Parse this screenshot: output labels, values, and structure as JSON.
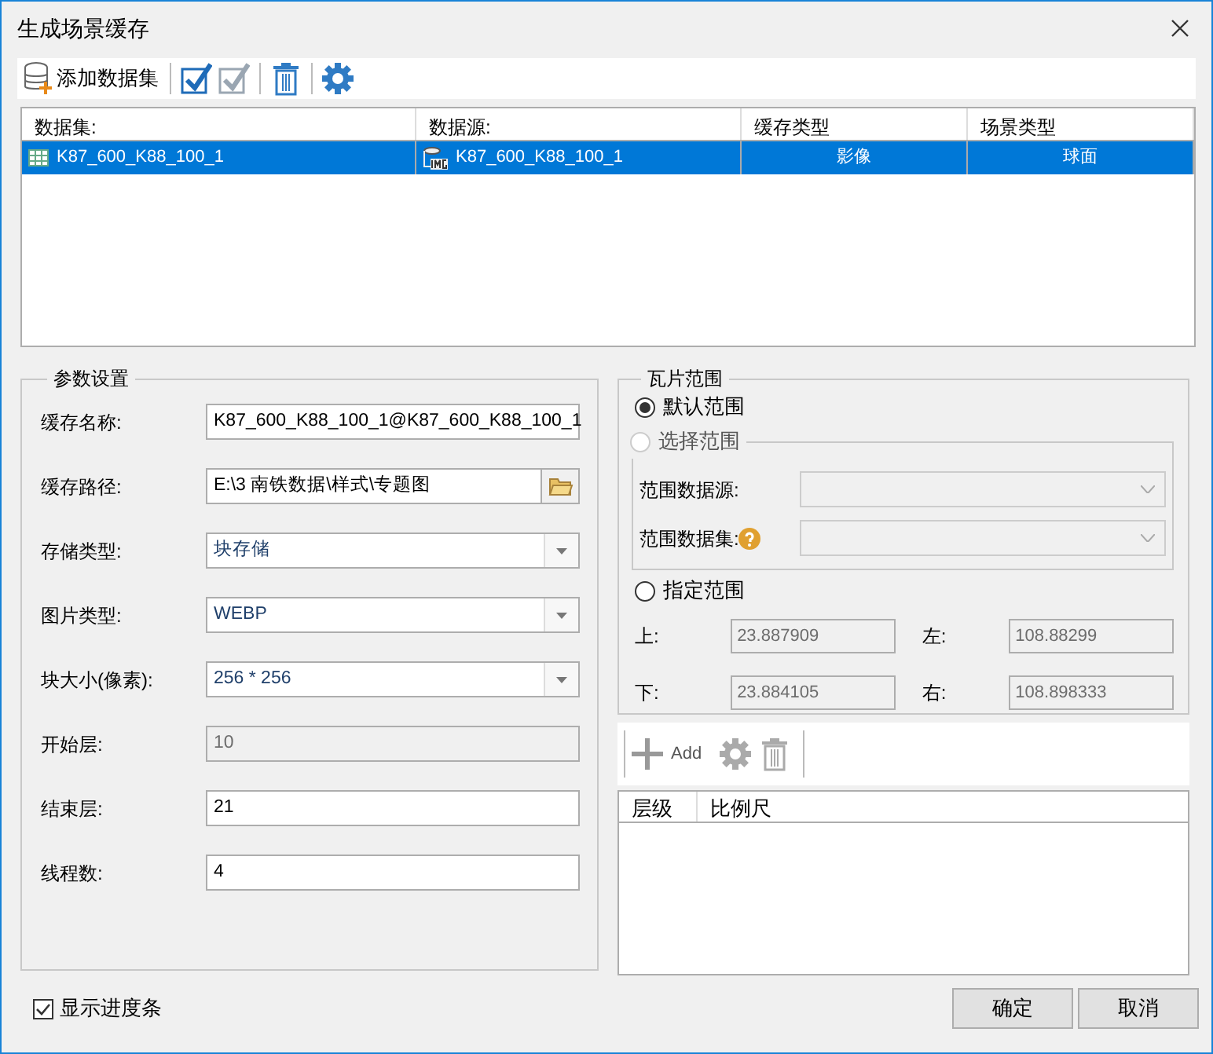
{
  "window": {
    "title": "生成场景缓存"
  },
  "toolbar": {
    "add_label": "添加数据集"
  },
  "datasets": {
    "columns": [
      "数据集:",
      "数据源:",
      "缓存类型",
      "场景类型"
    ],
    "rows": [
      {
        "selected": true,
        "cells": [
          "K87_600_K88_100_1",
          "K87_600_K88_100_1",
          "影像",
          "球面"
        ]
      }
    ]
  },
  "params": {
    "title": "参数设置",
    "fields": [
      {
        "kind": "text",
        "label": "缓存名称:",
        "value": "K87_600_K88_100_1@K87_600_K88_100_1",
        "disabled": false
      },
      {
        "kind": "path",
        "label": "缓存路径:",
        "value": "E:\\3 南铁数据\\样式\\专题图",
        "disabled": false
      },
      {
        "kind": "select",
        "label": "存储类型:",
        "value": "块存储",
        "disabled": false
      },
      {
        "kind": "select",
        "label": "图片类型:",
        "value": "WEBP",
        "disabled": false
      },
      {
        "kind": "select",
        "label": "块大小(像素):",
        "value": "256 * 256",
        "disabled": false
      },
      {
        "kind": "text",
        "label": "开始层:",
        "value": "10",
        "disabled": true
      },
      {
        "kind": "text",
        "label": "结束层:",
        "value": "21",
        "disabled": false
      },
      {
        "kind": "text",
        "label": "线程数:",
        "value": "4",
        "disabled": false
      }
    ]
  },
  "tile_range": {
    "title": "瓦片范围",
    "options": [
      {
        "label": "默认范围",
        "selected": true,
        "disabled": false
      },
      {
        "label": "选择范围",
        "selected": false,
        "disabled": true
      },
      {
        "label": "指定范围",
        "selected": false,
        "disabled": false
      }
    ],
    "sources": [
      {
        "label": "范围数据源:",
        "help": false
      },
      {
        "label": "范围数据集:",
        "help": true
      }
    ],
    "bounds": [
      {
        "label": "上:",
        "value": "23.887909",
        "disabled": true
      },
      {
        "label": "左:",
        "value": "108.88299",
        "disabled": true
      },
      {
        "label": "下:",
        "value": "23.884105",
        "disabled": true
      },
      {
        "label": "右:",
        "value": "108.898333",
        "disabled": true
      }
    ]
  },
  "levels": {
    "add_label": "Add",
    "columns": [
      "层级",
      "比例尺"
    ]
  },
  "show_progress": {
    "label": "显示进度条",
    "checked": true
  },
  "buttons": [
    "确定",
    "取消"
  ]
}
